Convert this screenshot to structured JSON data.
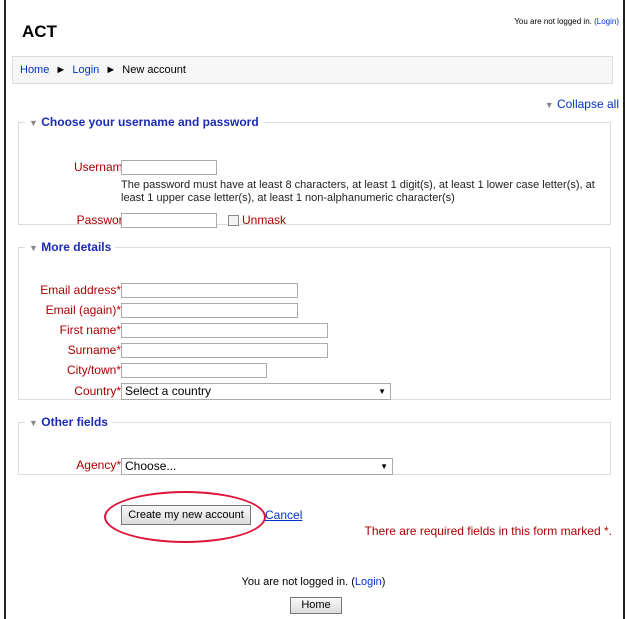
{
  "header": {
    "site_title": "ACT",
    "login_info_prefix": "You are not logged in.",
    "login_link": "(Login)"
  },
  "breadcrumb": {
    "home": "Home",
    "login": "Login",
    "current": "New account",
    "separator": "►"
  },
  "collapse_all": "Collapse all",
  "sections": {
    "credentials": {
      "legend": "Choose your username and password",
      "username_label": "Username",
      "password_hint": "The password must have at least 8 characters, at least 1 digit(s), at least 1 lower case letter(s), at least 1 upper case letter(s), at least 1 non-alphanumeric character(s)",
      "password_label": "Password",
      "unmask_label": "Unmask"
    },
    "details": {
      "legend": "More details",
      "email_label": "Email address",
      "email_again_label": "Email (again)",
      "first_name_label": "First name",
      "surname_label": "Surname",
      "city_label": "City/town",
      "country_label": "Country",
      "country_value": "Select a country"
    },
    "other": {
      "legend": "Other fields",
      "agency_label": "Agency",
      "agency_value": "Choose..."
    }
  },
  "required_marker": "*",
  "actions": {
    "submit_label": "Create my new account",
    "cancel_label": "Cancel",
    "required_note": "There are required fields in this form marked"
  },
  "footer": {
    "login_info_prefix": "You are not logged in. (",
    "login_link": "Login",
    "login_info_suffix": ")",
    "home_button": "Home"
  },
  "colors": {
    "legend": "#1a2bb3",
    "label": "#aa0000",
    "link": "#0033cc",
    "highlight_circle": "#e0133b"
  }
}
